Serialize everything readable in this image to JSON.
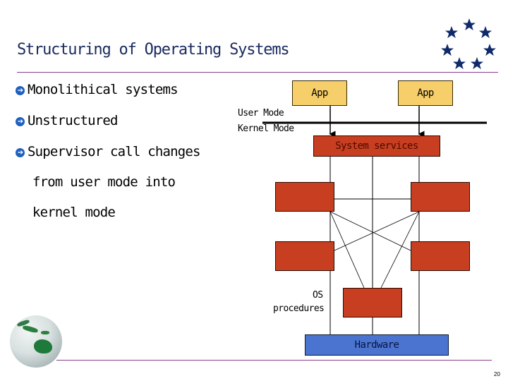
{
  "slide": {
    "title": "Structuring of Operating Systems",
    "page_number": "20",
    "colors": {
      "title": "#1a2a5e",
      "rule": "#8b3a8b",
      "app_box": "#f6cf6a",
      "os_box": "#c83e20",
      "hardware_box": "#4a74cf",
      "stars": "#0f2a6a",
      "bullet": "#1f5fbf"
    }
  },
  "bullets": [
    {
      "icon": "arrow-circle-icon",
      "text": "Monolithical systems"
    },
    {
      "icon": "arrow-circle-icon",
      "text": "Unstructured"
    },
    {
      "icon": "arrow-circle-icon",
      "text": "Supervisor call changes"
    }
  ],
  "continuation": [
    "from user mode into",
    "kernel mode"
  ],
  "diagram": {
    "apps": [
      "App",
      "App"
    ],
    "user_mode_label": "User Mode",
    "kernel_mode_label": "Kernel Mode",
    "system_services_label": "System services",
    "os_procedures_label_line1": "OS",
    "os_procedures_label_line2": "procedures",
    "hardware_label": "Hardware"
  }
}
